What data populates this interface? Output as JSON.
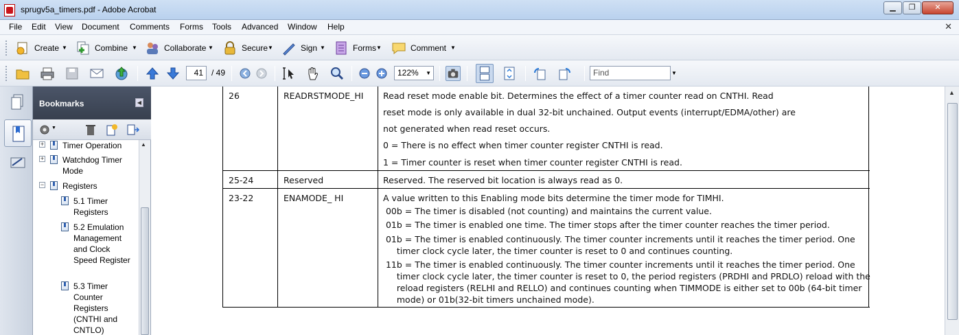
{
  "window": {
    "title": "sprugv5a_timers.pdf - Adobe Acrobat",
    "min": "▁",
    "max": "❐",
    "close": "✕"
  },
  "menu": [
    "File",
    "Edit",
    "View",
    "Document",
    "Comments",
    "Forms",
    "Tools",
    "Advanced",
    "Window",
    "Help"
  ],
  "menu_close": "✕",
  "toolbar1": [
    {
      "label": "Create",
      "icon": "create-icon"
    },
    {
      "label": "Combine",
      "icon": "combine-icon"
    },
    {
      "label": "Collaborate",
      "icon": "collaborate-icon"
    },
    {
      "label": "Secure",
      "icon": "lock-icon"
    },
    {
      "label": "Sign",
      "icon": "pen-icon"
    },
    {
      "label": "Forms",
      "icon": "forms-icon"
    },
    {
      "label": "Comment",
      "icon": "comment-icon"
    }
  ],
  "toolbar2": {
    "page": "41",
    "page_total": "/ 49",
    "zoom": "122%",
    "find_placeholder": "Find"
  },
  "bookmarks": {
    "title": "Bookmarks",
    "items": [
      {
        "label": "Timer Operation",
        "level": 0,
        "expander": "+"
      },
      {
        "label": "Watchdog Timer Mode",
        "level": 0,
        "expander": "+"
      },
      {
        "label": "Registers",
        "level": 0,
        "expander": "−"
      },
      {
        "label": "5.1 Timer Registers",
        "level": 1
      },
      {
        "label": "5.2 Emulation Management and Clock Speed Register",
        "level": 1
      },
      {
        "label": "5.3 Timer Counter Registers (CNTHI and CNTLO)",
        "level": 1
      }
    ]
  },
  "table": {
    "rows": [
      {
        "bit": "26",
        "field": "READRSTMODE_HI",
        "lines": [
          "Read reset mode enable bit. Determines the effect of a timer counter read on CNTHI. Read",
          "reset mode is only available in dual 32-bit unchained. Output events (interrupt/EDMA/other) are",
          "not generated when read reset occurs.",
          "0 = There is no effect when timer counter register CNTHI is read.",
          "1 = Timer counter is reset when timer counter register CNTHI is read."
        ]
      },
      {
        "bit": "25-24",
        "field": "Reserved",
        "lines": [
          "Reserved. The reserved bit location is always read as 0."
        ]
      },
      {
        "bit": "23-22",
        "field": "ENAMODE_ HI",
        "lines": [
          "A value written to this Enabling mode bits determine the timer mode for TIMHI.",
          " 00b = The timer is disabled (not counting) and maintains the current value.",
          " 01b = The timer is enabled one time. The timer stops after the timer counter reaches the timer period.",
          " 01b = The timer is enabled continuously. The timer counter increments until it reaches the timer period. One",
          "     timer clock cycle later, the timer counter is reset to 0 and continues counting.",
          " 11b = The timer is enabled continuously. The timer counter increments until it reaches the timer period. One",
          "     timer clock cycle later, the timer counter is reset to 0, the period registers (PRDHI and PRDLO) reload with the",
          "     reload registers (RELHI and RELLO) and continues counting when TIMMODE is either set to 00b (64-bit timer",
          "     mode) or 01b(32-bit timers unchained mode)."
        ]
      }
    ]
  }
}
